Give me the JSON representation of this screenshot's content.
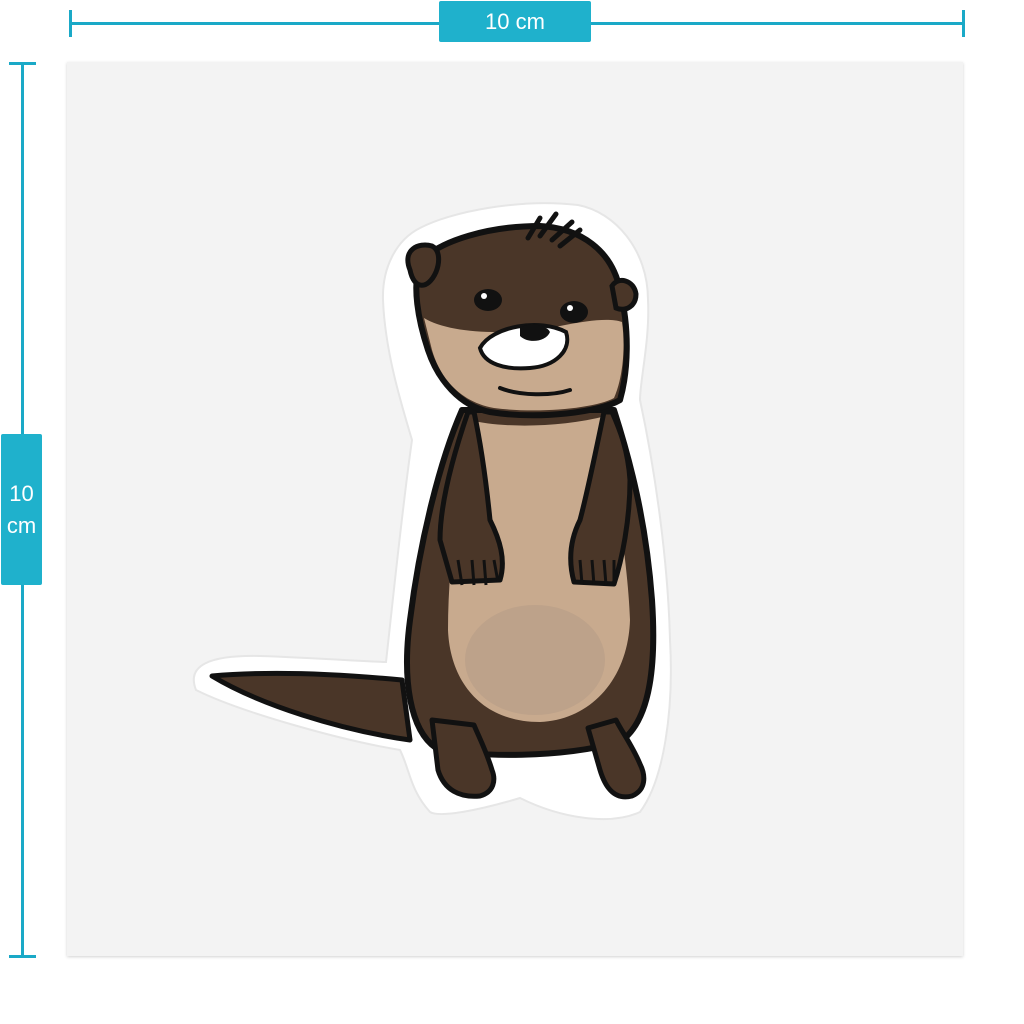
{
  "dimensions": {
    "width_label": "10 cm",
    "height_value": "10",
    "height_unit": "cm"
  },
  "colors": {
    "accent": "#1fb1cc",
    "fur_dark": "#4a3628",
    "fur_light": "#c8aa8e",
    "outline": "#111111",
    "sheet": "#f3f3f3"
  },
  "sticker": {
    "subject": "otter-illustration"
  }
}
